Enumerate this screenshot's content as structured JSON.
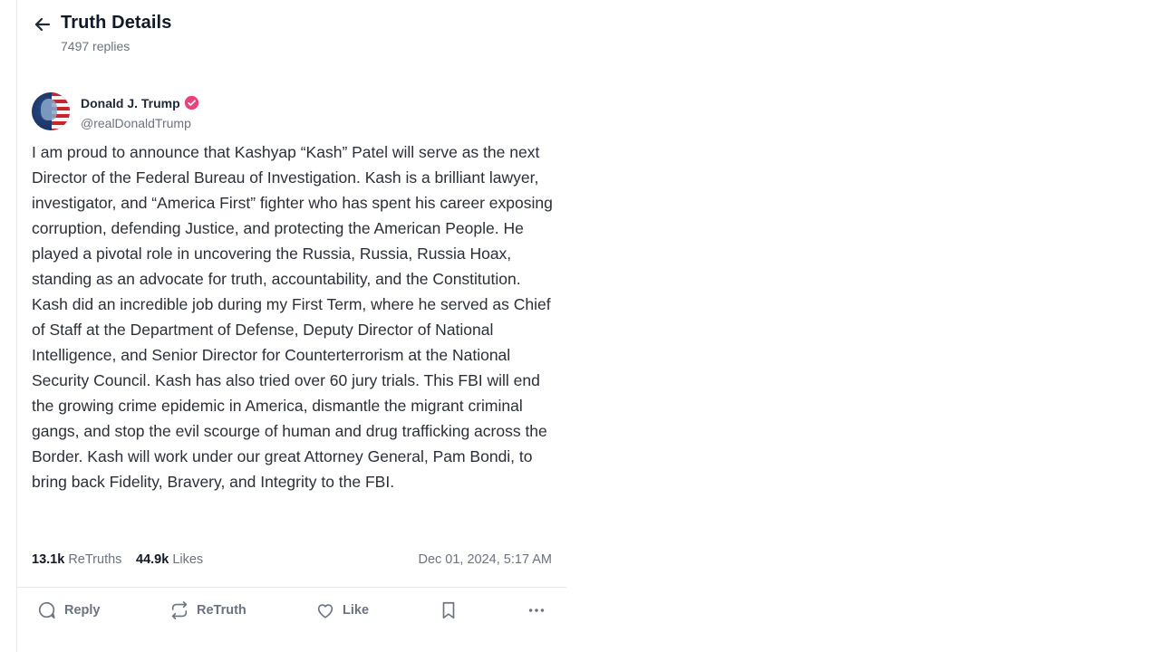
{
  "header": {
    "title": "Truth Details",
    "subtitle": "7497 replies"
  },
  "post": {
    "author_name": "Donald J. Trump",
    "handle": "@realDonaldTrump",
    "verified": true,
    "body": "I am proud to announce that Kashyap “Kash” Patel will serve as the next Director of the Federal Bureau of Investigation. Kash is a brilliant lawyer, investigator, and “America First” fighter who has spent his career exposing corruption, defending Justice, and protecting the American People. He played a pivotal role in uncovering the Russia, Russia, Russia Hoax, standing as an advocate for truth, accountability, and the Constitution. Kash did an incredible job during my First Term, where he served as Chief of Staff at the Department of Defense, Deputy Director of National Intelligence, and Senior Director for Counterterrorism at the National Security Council. Kash has also tried over 60 jury trials. This FBI will end the growing crime epidemic in America, dismantle the migrant criminal gangs, and stop the evil scourge of human and drug trafficking across the Border. Kash will work under our great Attorney General, Pam Bondi, to bring back Fidelity, Bravery, and Integrity to the FBI.",
    "retruths_count": "13.1k",
    "retruths_label": "ReTruths",
    "likes_count": "44.9k",
    "likes_label": "Likes",
    "timestamp": "Dec 01, 2024, 5:17 AM"
  },
  "actions": {
    "reply": "Reply",
    "retruth": "ReTruth",
    "like": "Like"
  },
  "icons": {
    "back": "arrow-left-icon",
    "verified": "verified-badge-icon",
    "reply": "comment-icon",
    "retruth": "repost-icon",
    "like": "heart-icon",
    "bookmark": "bookmark-icon",
    "more": "more-horizontal-icon"
  },
  "colors": {
    "verified_badge": "#e8437a",
    "muted_text": "#6b7280",
    "primary_text": "#111827"
  }
}
